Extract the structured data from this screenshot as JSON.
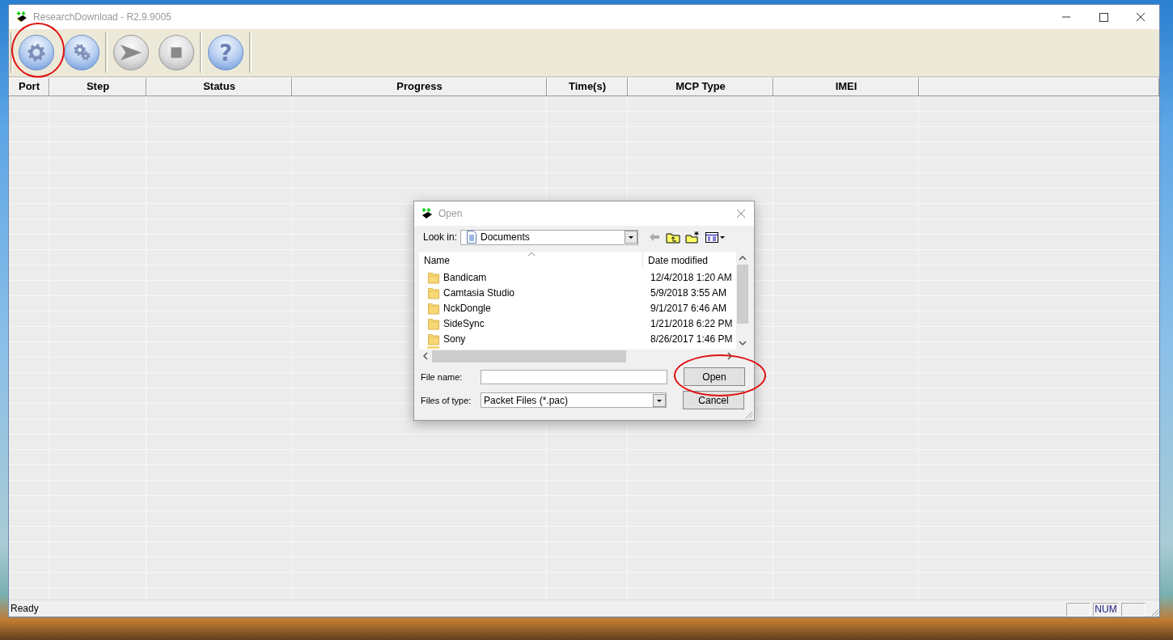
{
  "window": {
    "title": "ResearchDownload - R2.9.9005"
  },
  "toolbar": {
    "groups": [
      [
        {
          "kind": "gear",
          "disabled": false
        },
        {
          "kind": "gears",
          "disabled": false
        }
      ],
      [
        {
          "kind": "send",
          "disabled": true
        },
        {
          "kind": "stop",
          "disabled": true
        }
      ],
      [
        {
          "kind": "help",
          "disabled": false,
          "glyph": "?"
        }
      ]
    ]
  },
  "table": {
    "columns": [
      "Port",
      "Step",
      "Status",
      "Progress",
      "Time(s)",
      "MCP Type",
      "IMEI"
    ]
  },
  "status_bar": {
    "text": "Ready",
    "num_indicator": "NUM"
  },
  "dialog": {
    "title": "Open",
    "look_in": {
      "label": "Look in:",
      "value": "Documents"
    },
    "columns": [
      "Name",
      "Date modified"
    ],
    "files": [
      {
        "name": "Bandicam",
        "date": "12/4/2018 1:20 AM"
      },
      {
        "name": "Camtasia Studio",
        "date": "5/9/2018 3:55 AM"
      },
      {
        "name": "NckDongle",
        "date": "9/1/2017 6:46 AM"
      },
      {
        "name": "SideSync",
        "date": "1/21/2018 6:22 PM"
      },
      {
        "name": "Sony",
        "date": "8/26/2017 1:46 PM"
      }
    ],
    "file_name_label": "File name:",
    "file_type": {
      "label": "Files of type:",
      "value": "Packet Files (*.pac)"
    },
    "buttons": [
      "Open",
      "Cancel"
    ]
  }
}
